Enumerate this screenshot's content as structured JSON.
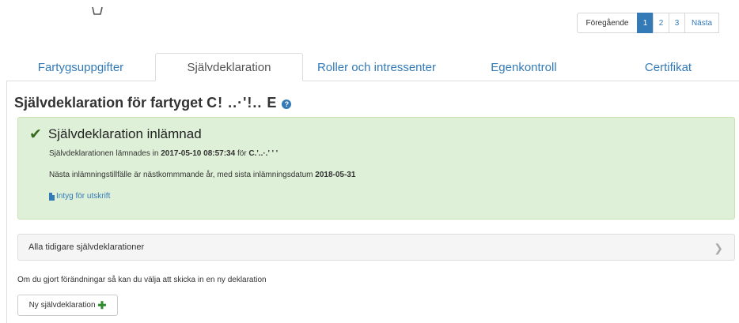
{
  "pagination": {
    "prev_label": "Föregående",
    "pages": [
      "1",
      "2",
      "3"
    ],
    "active_page": "1",
    "next_label": "Nästa"
  },
  "tabs": [
    {
      "label": "Fartygsuppgifter",
      "active": false
    },
    {
      "label": "Självdeklaration",
      "active": true
    },
    {
      "label": "Roller och intressenter",
      "active": false
    },
    {
      "label": "Egenkontroll",
      "active": false
    },
    {
      "label": "Certifikat",
      "active": false
    }
  ],
  "page_title": {
    "prefix": "Självdeklaration för fartyget",
    "vessel_name_redacted": "C! ..·'!.. E"
  },
  "status": {
    "heading": "Självdeklaration inlämnad",
    "submitted_prefix": "Självdeklarationen lämnades in",
    "submitted_datetime": "2017-05-10 08:57:34",
    "submitted_for": "för",
    "submitted_by_redacted": "C.'..·.' ' '",
    "next_prefix": "Nästa inlämningstillfälle är nästkommmande år, med sista inlämningsdatum",
    "next_deadline": "2018-05-31",
    "print_link": "Intyg för utskrift"
  },
  "history": {
    "label": "Alla tidigare självdeklarationer"
  },
  "info_text": "Om du gjort förändningar så kan du välja att skicka in en ny deklaration",
  "new_button_label": "Ny självdeklaration",
  "colors": {
    "accent": "#337ab7",
    "success_bg": "#dff0d8",
    "success_icon": "#3a6b1f",
    "add_icon": "#2e8b2e"
  }
}
